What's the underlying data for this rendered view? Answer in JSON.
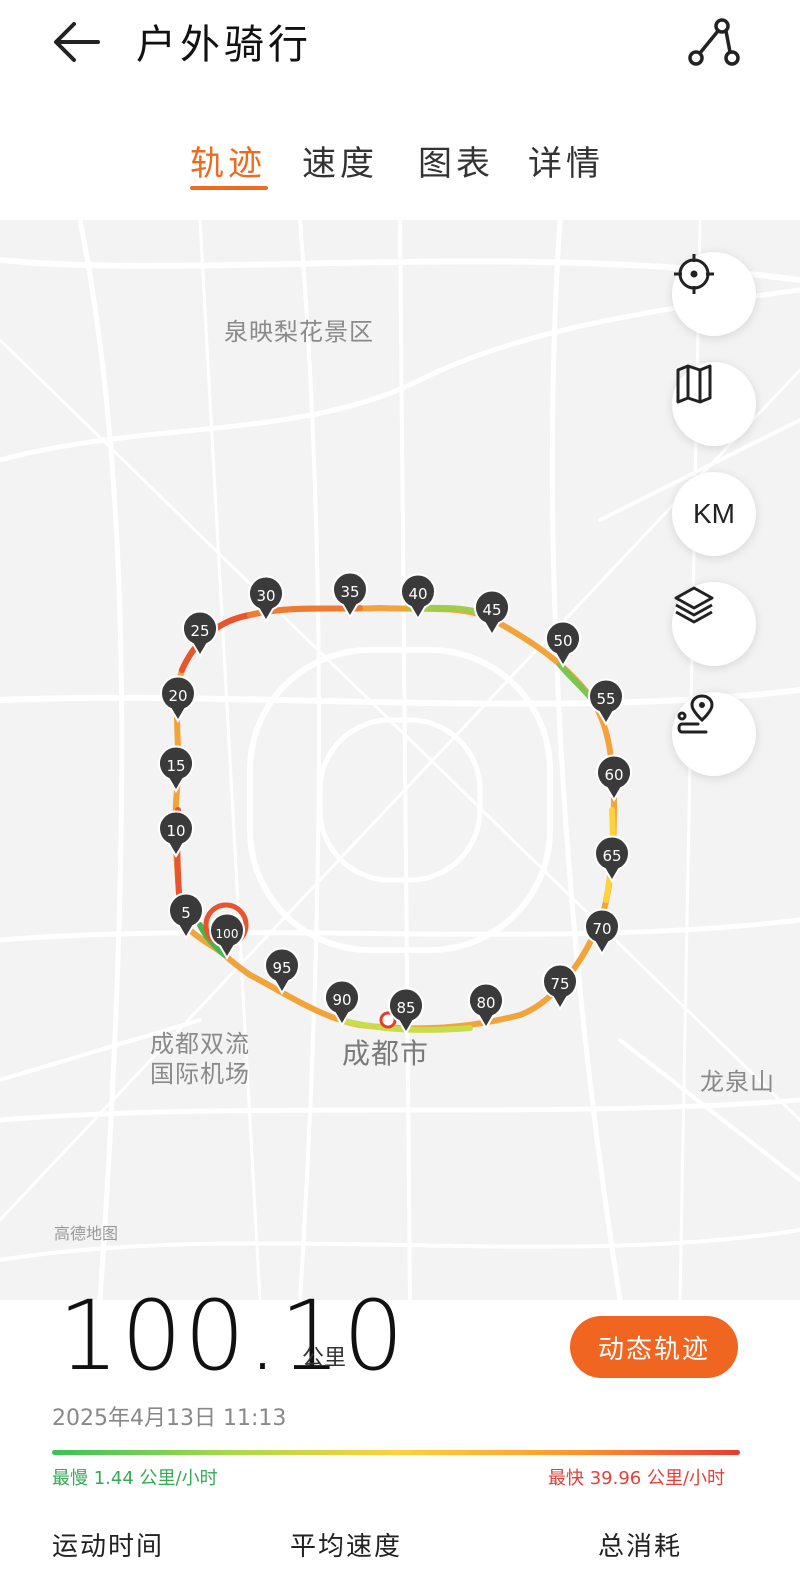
{
  "header": {
    "title": "户外骑行",
    "back_icon": "back-arrow-icon",
    "route_icon": "route-share-icon"
  },
  "tabs": [
    {
      "label": "轨迹",
      "active": true
    },
    {
      "label": "速度",
      "active": false
    },
    {
      "label": "图表",
      "active": false
    },
    {
      "label": "详情",
      "active": false
    }
  ],
  "map": {
    "places": {
      "scenic": "泉映梨花景区",
      "airport_line1": "成都双流",
      "airport_line2": "国际机场",
      "city": "成都市",
      "longquan": "龙泉山"
    },
    "provider_logo": "高德地图",
    "markers": [
      "5",
      "10",
      "15",
      "20",
      "25",
      "30",
      "35",
      "40",
      "45",
      "50",
      "55",
      "60",
      "65",
      "70",
      "75",
      "80",
      "85",
      "90",
      "95",
      "100"
    ],
    "controls": [
      {
        "name": "locate-icon"
      },
      {
        "name": "map-icon"
      },
      {
        "name": "km-toggle",
        "label": "KM"
      },
      {
        "name": "layers-icon"
      },
      {
        "name": "route-pin-icon"
      }
    ],
    "colors": {
      "slow": "#37c25a",
      "mid": "#ffd23a",
      "fast": "#e93a30"
    }
  },
  "summary": {
    "distance": "100.10",
    "distance_unit": "公里",
    "replay_label": "动态轨迹",
    "datetime": "2025年4月13日 11:13",
    "speed_min": "最慢 1.44 公里/小时",
    "speed_max": "最快 39.96 公里/小时"
  },
  "stats": {
    "time_label": "运动时间",
    "avg_speed_label": "平均速度",
    "calories_label": "总消耗"
  }
}
